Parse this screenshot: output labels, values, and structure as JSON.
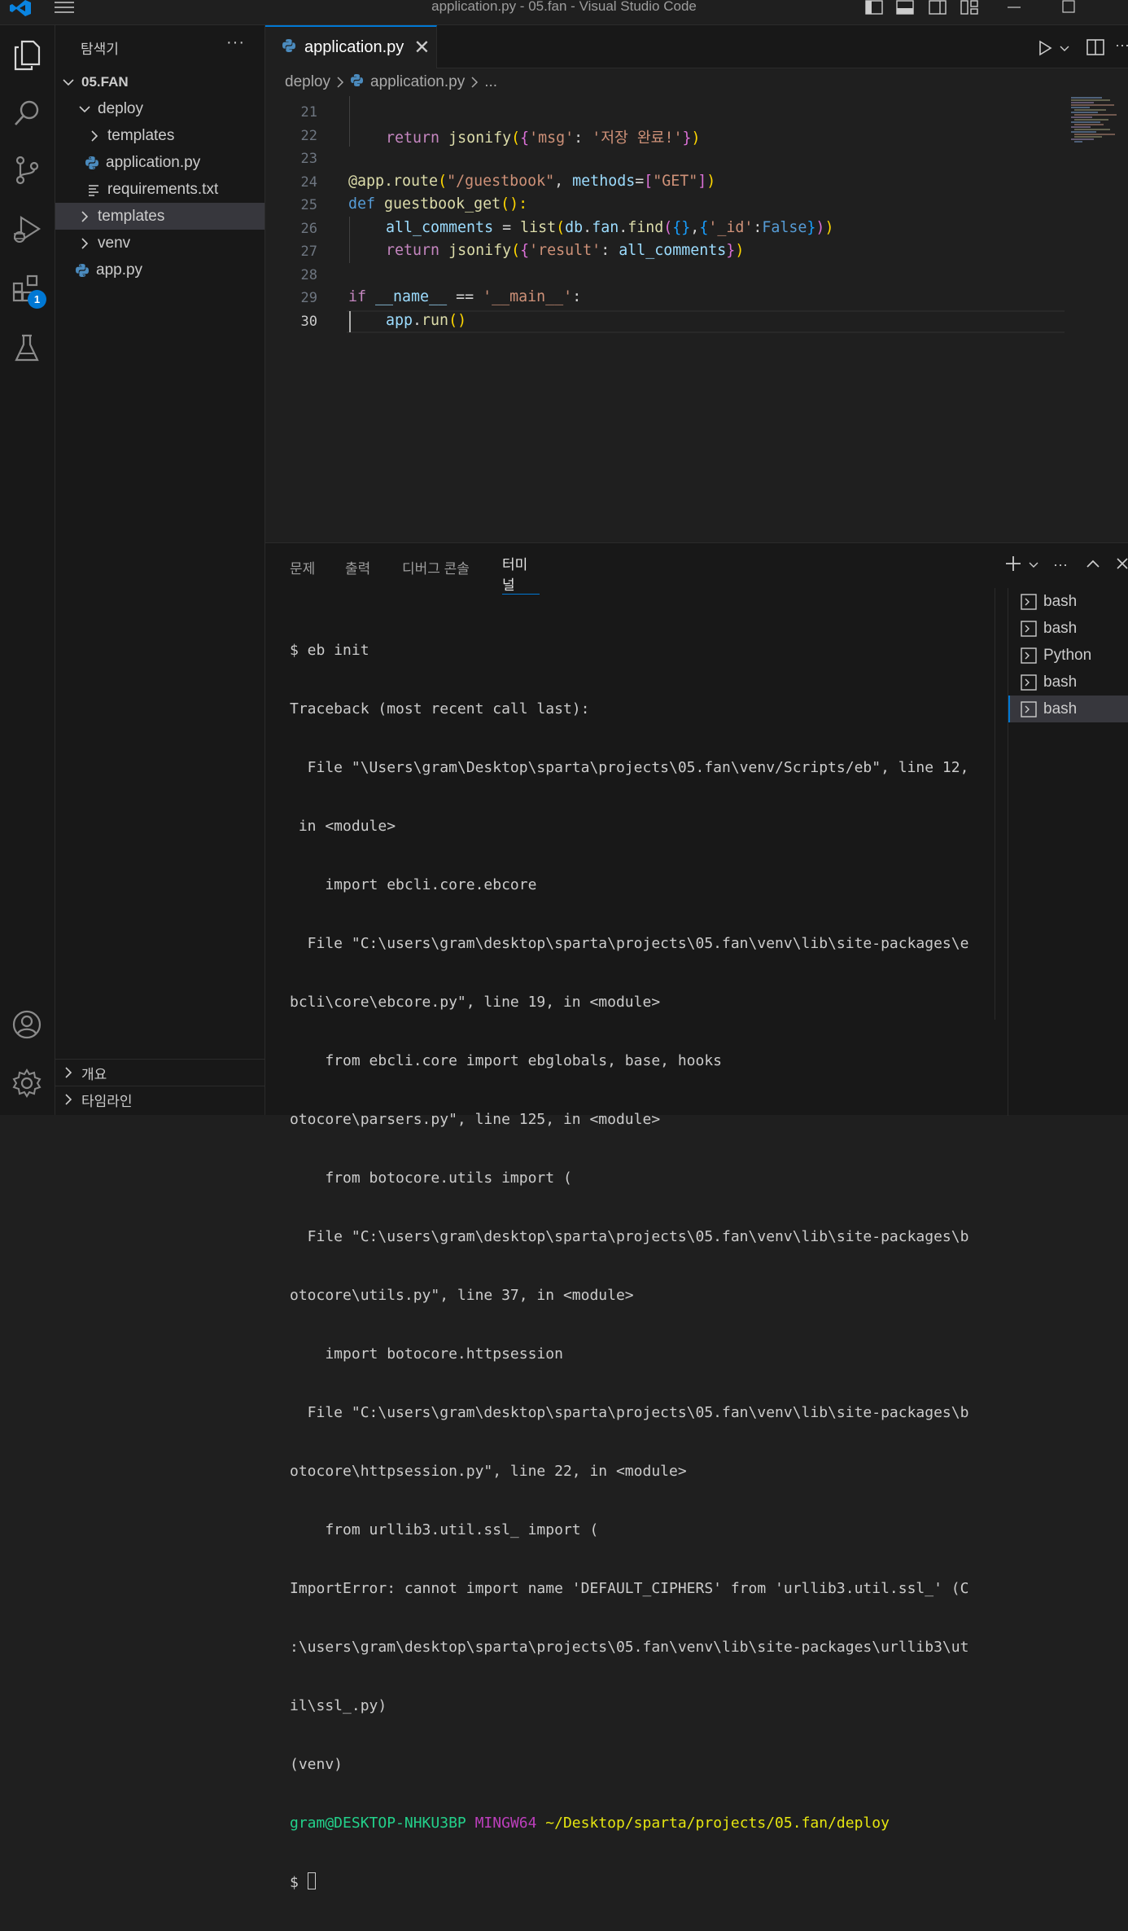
{
  "window": {
    "title": "application.py - 05.fan - Visual Studio Code"
  },
  "activity": {
    "extensions_badge": "1"
  },
  "sidebar": {
    "header": "탐색기",
    "more": "···",
    "tree": [
      {
        "label": "05.FAN"
      },
      {
        "label": "deploy"
      },
      {
        "label": "templates"
      },
      {
        "label": "application.py"
      },
      {
        "label": "requirements.txt"
      },
      {
        "label": "templates"
      },
      {
        "label": "venv"
      },
      {
        "label": "app.py"
      }
    ],
    "outline": "개요",
    "timeline": "타임라인"
  },
  "tab": {
    "label": "application.py",
    "close": "✕"
  },
  "breadcrumb": {
    "folder": "deploy",
    "file": "application.py",
    "rest": "..."
  },
  "editor": {
    "line_numbers": [
      "21",
      "22",
      "23",
      "24",
      "25",
      "26",
      "27",
      "28",
      "29",
      "30"
    ],
    "l22": {
      "ret": "return",
      "fn": "jsonify",
      "p1": "(",
      "p2": "{",
      "k": "'msg'",
      "colon": ": ",
      "v": "'저장 완료!'",
      "p2c": "}",
      "p1c": ")"
    },
    "l24": {
      "dec": "@app.route",
      "p1": "(",
      "route": "\"/guestbook\"",
      "comma": ", ",
      "kw": "methods",
      "eq": "=",
      "p2": "[",
      "get": "\"GET\"",
      "p2c": "]",
      "p1c": ")"
    },
    "l25": {
      "def": "def",
      "fn": "guestbook_get",
      "parens": "():"
    },
    "l26": {
      "var": "all_comments",
      "eq": " = ",
      "list": "list",
      "p1": "(",
      "db": "db",
      "dot1": ".",
      "fan": "fan",
      "dot2": ".",
      "find": "find",
      "p2": "(",
      "b1": "{}",
      "comma": ",",
      "b2": "{",
      "id": "'_id'",
      "colon": ":",
      "false": "False",
      "b2c": "}",
      "p2c": ")",
      "p1c": ")"
    },
    "l27": {
      "ret": "return",
      "fn": "jsonify",
      "p1": "(",
      "p2": "{",
      "k": "'result'",
      "colon": ": ",
      "v": "all_comments",
      "p2c": "}",
      "p1c": ")"
    },
    "l29": {
      "if": "if",
      "name": "__name__",
      "eq": " == ",
      "main": "'__main__'",
      "colon": ":"
    },
    "l30": {
      "app": "app",
      "dot": ".",
      "run": "run",
      "paren": "()"
    }
  },
  "panel": {
    "tabs": [
      "문제",
      "출력",
      "디버그 콘솔",
      "터미널"
    ],
    "terminal_lines": [
      "$ eb init",
      "Traceback (most recent call last):",
      "  File \"\\Users\\gram\\Desktop\\sparta\\projects\\05.fan\\venv/Scripts/eb\", line 12,",
      " in <module>",
      "    import ebcli.core.ebcore",
      "  File \"C:\\users\\gram\\desktop\\sparta\\projects\\05.fan\\venv\\lib\\site-packages\\e",
      "bcli\\core\\ebcore.py\", line 19, in <module>",
      "    from ebcli.core import ebglobals, base, hooks",
      "otocore\\parsers.py\", line 125, in <module>",
      "    from botocore.utils import (",
      "  File \"C:\\users\\gram\\desktop\\sparta\\projects\\05.fan\\venv\\lib\\site-packages\\b",
      "otocore\\utils.py\", line 37, in <module>",
      "    import botocore.httpsession",
      "  File \"C:\\users\\gram\\desktop\\sparta\\projects\\05.fan\\venv\\lib\\site-packages\\b",
      "otocore\\httpsession.py\", line 22, in <module>",
      "    from urllib3.util.ssl_ import (",
      "ImportError: cannot import name 'DEFAULT_CIPHERS' from 'urllib3.util.ssl_' (C",
      ":\\users\\gram\\desktop\\sparta\\projects\\05.fan\\venv\\lib\\site-packages\\urllib3\\ut",
      "il\\ssl_.py)",
      "(venv)"
    ],
    "prompt": {
      "user": "gram@DESKTOP-NHKU3BP",
      "env": "MINGW64",
      "path": "~/Desktop/sparta/projects/05.fan/deploy",
      "dollar": "$ "
    },
    "terminals": [
      "bash",
      "bash",
      "Python",
      "bash",
      "bash"
    ]
  },
  "colors": {
    "accent": "#0078d4",
    "background": "#1f1f1f"
  }
}
